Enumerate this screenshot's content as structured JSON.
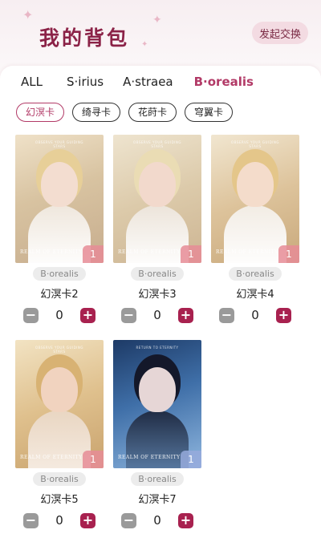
{
  "header": {
    "title": "我的背包",
    "exchange_button": "发起交换"
  },
  "tabs": [
    {
      "label": "ALL",
      "active": false
    },
    {
      "label": "S·irius",
      "active": false
    },
    {
      "label": "A·straea",
      "active": false
    },
    {
      "label": "B·orealis",
      "active": true
    }
  ],
  "filters": [
    {
      "label": "幻溟卡",
      "active": true
    },
    {
      "label": "绮寻卡",
      "active": false
    },
    {
      "label": "花莳卡",
      "active": false
    },
    {
      "label": "穹翼卡",
      "active": false
    }
  ],
  "cards": [
    {
      "name": "幻溟卡2",
      "group": "B·orealis",
      "count": "1",
      "quantity": "0",
      "logo": "REALM OF ETERNITY"
    },
    {
      "name": "幻溟卡3",
      "group": "B·orealis",
      "count": "1",
      "quantity": "0",
      "logo": "REALM OF ETERNITY"
    },
    {
      "name": "幻溟卡4",
      "group": "B·orealis",
      "count": "1",
      "quantity": "0",
      "logo": "REALM OF ETERNITY"
    },
    {
      "name": "幻溟卡5",
      "group": "B·orealis",
      "count": "1",
      "quantity": "0",
      "logo": "REALM OF ETERNITY"
    },
    {
      "name": "幻溟卡7",
      "group": "B·orealis",
      "count": "1",
      "quantity": "0",
      "logo": "REALM OF ETERNITY"
    }
  ],
  "stepper": {
    "minus": "−",
    "plus": "+"
  },
  "colors": {
    "accent": "#b23a67",
    "title": "#8b2247",
    "plus_button": "#a8214f"
  }
}
